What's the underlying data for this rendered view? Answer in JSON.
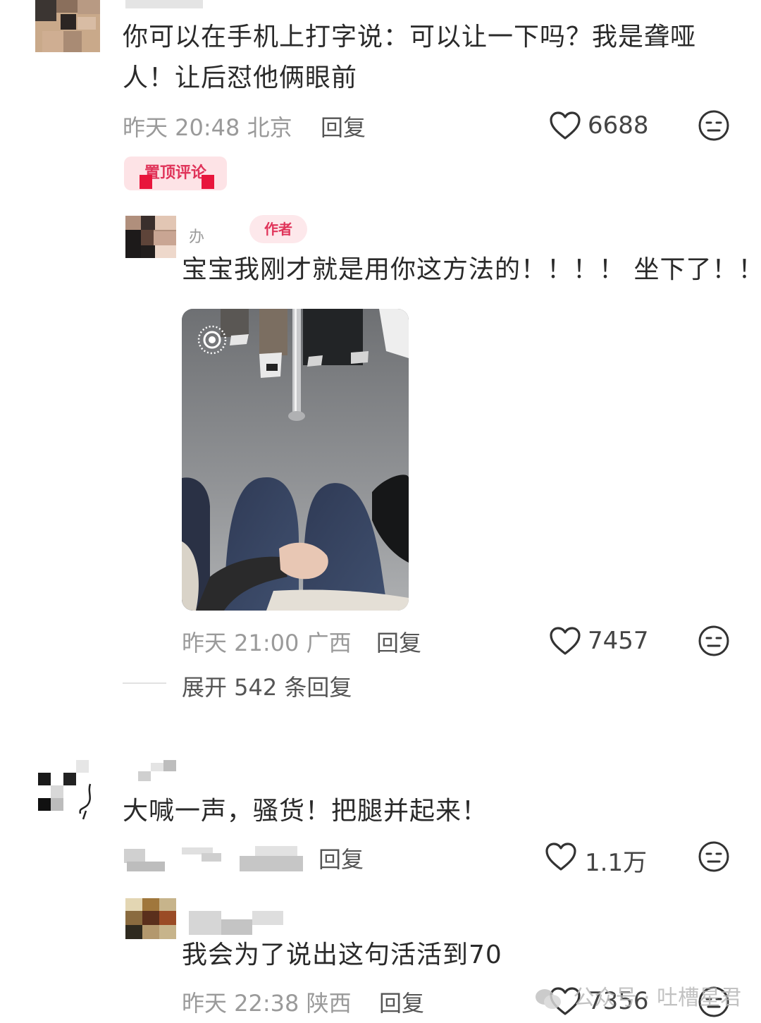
{
  "comment1": {
    "text": "你可以在手机上打字说：可以让一下吗？我是聋哑人！让后怼他俩眼前",
    "line1": "你可以在手机上打字说：可以让一下吗？我是聋哑",
    "line2": "人！让后怼他俩眼前",
    "time": "昨天 20:48 北京",
    "reply_label": "回复",
    "likes": "6688",
    "pinned_label": "置顶评论"
  },
  "reply1": {
    "username": "办",
    "author_tag": "作者",
    "text": "宝宝我刚才就是用你这方法的！！！！ 坐下了！！",
    "time": "昨天 21:00 广西",
    "reply_label": "回复",
    "likes": "7457",
    "expand_label": "展开 542 条回复"
  },
  "comment2": {
    "text": "大喊一声，骚货！把腿并起来！",
    "reply_label": "回复",
    "likes": "1.1万"
  },
  "reply2": {
    "text": "我会为了说出这句活活到70",
    "time": "昨天 22:38 陕西",
    "reply_label": "回复",
    "likes": "7356"
  },
  "watermark": {
    "text": "公众号 · 吐槽星君"
  },
  "icons": {
    "like": "heart-outline-icon",
    "dislike": "meh-face-icon",
    "live": "live-photo-icon"
  },
  "colors": {
    "pin_tag_bg": "#fde3e6",
    "pin_tag_text": "#e0345a",
    "meta_text": "#9a9a9a"
  }
}
